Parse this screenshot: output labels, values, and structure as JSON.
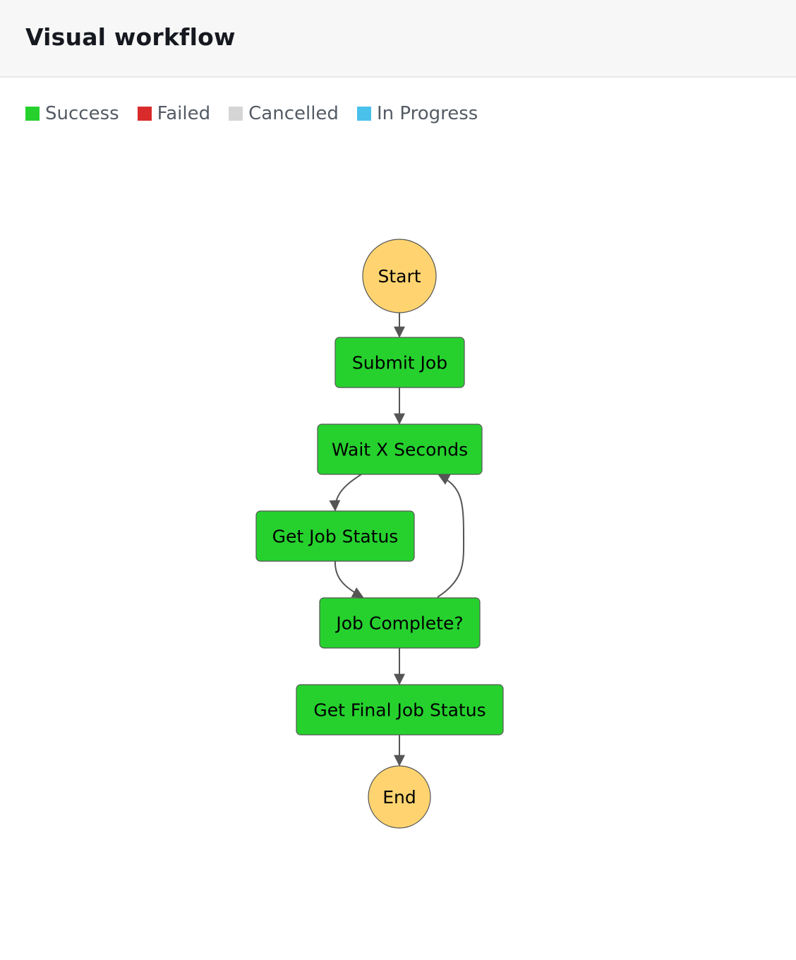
{
  "header": {
    "title": "Visual workflow"
  },
  "legend": [
    {
      "label": "Success",
      "color": "#26d12e"
    },
    {
      "label": "Failed",
      "color": "#d92b2b"
    },
    {
      "label": "Cancelled",
      "color": "#d5d5d5"
    },
    {
      "label": "In Progress",
      "color": "#4ac1eb"
    }
  ],
  "colors": {
    "terminal_fill": "#ffd470",
    "success_fill": "#26d12e",
    "node_stroke": "#555555",
    "edge": "#555555"
  },
  "workflow": {
    "nodes": [
      {
        "id": "start",
        "label": "Start",
        "type": "terminal"
      },
      {
        "id": "submit",
        "label": "Submit Job",
        "type": "task",
        "status": "Success"
      },
      {
        "id": "wait",
        "label": "Wait X Seconds",
        "type": "task",
        "status": "Success"
      },
      {
        "id": "getstatus",
        "label": "Get Job Status",
        "type": "task",
        "status": "Success"
      },
      {
        "id": "complete",
        "label": "Job Complete?",
        "type": "task",
        "status": "Success"
      },
      {
        "id": "final",
        "label": "Get Final Job Status",
        "type": "task",
        "status": "Success"
      },
      {
        "id": "end",
        "label": "End",
        "type": "terminal"
      }
    ],
    "edges": [
      {
        "from": "start",
        "to": "submit"
      },
      {
        "from": "submit",
        "to": "wait"
      },
      {
        "from": "wait",
        "to": "getstatus"
      },
      {
        "from": "getstatus",
        "to": "complete"
      },
      {
        "from": "complete",
        "to": "wait"
      },
      {
        "from": "complete",
        "to": "final"
      },
      {
        "from": "final",
        "to": "end"
      }
    ]
  }
}
